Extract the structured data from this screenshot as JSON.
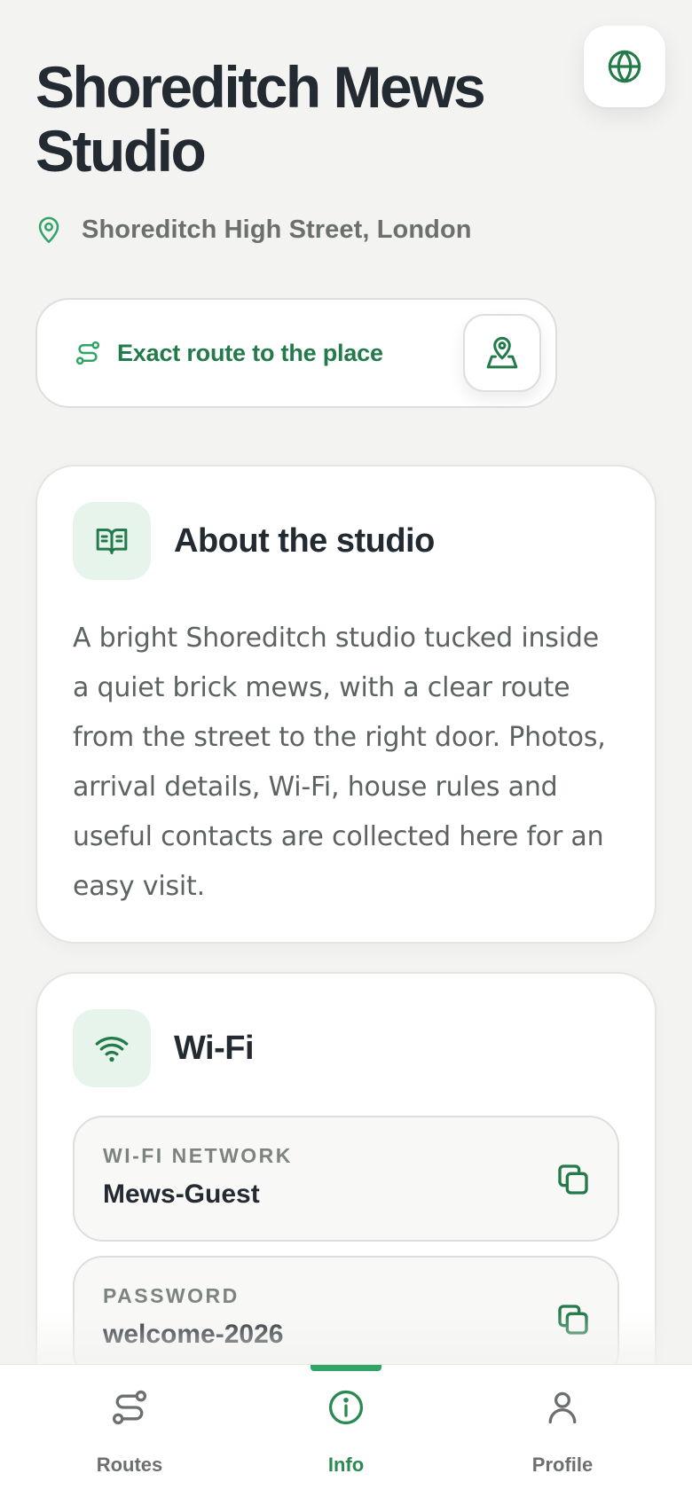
{
  "header": {
    "title_line1": "Shoreditch Mews",
    "title_line2": "Studio",
    "location": "Shoreditch High Street, London"
  },
  "route": {
    "label": "Exact route to the place"
  },
  "about": {
    "title": "About the studio",
    "body": "A bright Shoreditch studio tucked inside a quiet brick mews, with a clear route from the street to the right door. Photos, arrival details, Wi-Fi, house rules and useful contacts are collected here for an easy visit."
  },
  "wifi": {
    "title": "Wi-Fi",
    "network_label": "WI-FI NETWORK",
    "network_value": "Mews-Guest",
    "password_label": "PASSWORD",
    "password_value": "welcome-2026"
  },
  "tabbar": {
    "tabs": [
      {
        "label": "Routes",
        "icon": "route-icon",
        "active": false
      },
      {
        "label": "Info",
        "icon": "info-icon",
        "active": true
      },
      {
        "label": "Profile",
        "icon": "user-icon",
        "active": false
      }
    ]
  },
  "colors": {
    "accent": "#237a4a",
    "accent_light": "#e7f4ec",
    "background": "#f3f3f1",
    "text": "#232a31",
    "muted": "#6b706d"
  },
  "icons": {
    "language": "globe-icon",
    "location": "map-pin-icon",
    "map": "map-location-icon",
    "about": "book-open-icon",
    "wifi": "wifi-icon",
    "copy": "copy-icon"
  }
}
